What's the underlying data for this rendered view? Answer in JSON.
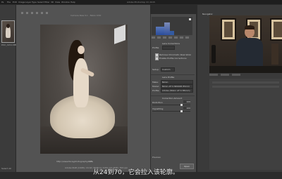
{
  "app": {
    "title": "Adobe Photoshop CC 2015",
    "document_tab": "Camera Raw 9.1 - Nikon D3X",
    "menu": [
      "Ps",
      "File",
      "Edit",
      "Image",
      "Layer",
      "Type",
      "Select",
      "Filter",
      "3D",
      "View",
      "Window",
      "Help"
    ]
  },
  "filmstrip": {
    "thumb_label": "DSC_4211.NEF",
    "bottom_label": "Select All"
  },
  "canvas": {
    "status_left": "http://www.faceyphotography.com",
    "status_right": "10%",
    "bottom_info": "Adobe RGB (1998); 16 bit; 6048 by 4032 (24.4MP); 300 ppi"
  },
  "right_panel": {
    "section_title": "Lens Corrections",
    "rows": {
      "profile": "Profile",
      "profile_value": "Default",
      "remove_chroma": "Remove Chromatic Aberration",
      "enable_profile": "Enable Profile Corrections",
      "setup_label": "Setup:",
      "setup_value": "Custom",
      "lens_profile": "Lens Profile",
      "make_label": "Make:",
      "make_value": "Nikon",
      "model_label": "Model:",
      "model_value": "Nikon AF-S NIKKOR 85mm",
      "profile_label": "Profile:",
      "profile_value2": "Adobe (Nikon AF-S 85mm)",
      "correction_amount": "Correction Amount",
      "distortion_label": "Distortion",
      "distortion_value": "100",
      "vignetting_label": "Vignetting",
      "vignetting_value": "100"
    },
    "bottom_row": "Preview",
    "ok_label": "Open"
  },
  "ps_panels": {
    "navigator_tab": "Navigator",
    "layers_tabs": [
      "Layers",
      "Channels",
      "Paths"
    ]
  },
  "video": {
    "subtitle": "从24到70，它会拉入该轮廓。"
  },
  "colors": {
    "accent_histogram": "#2a4c9a",
    "panel_bg": "#4a4a4a",
    "canvas_bg": "#535353"
  }
}
